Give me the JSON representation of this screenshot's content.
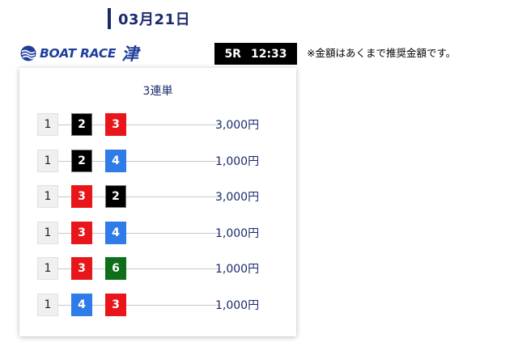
{
  "date": "03月21日",
  "logo": {
    "text": "BOAT RACE",
    "venue": "津"
  },
  "race": {
    "number": "5R",
    "time": "12:33"
  },
  "note": "※金額はあくまで推奨金額です。",
  "bet_type": "3連単",
  "colors": {
    "1": "#f0f0f0",
    "2": "#000000",
    "3": "#e8161b",
    "4": "#2f7be8",
    "6": "#0f6e19",
    "navy": "#1a2a6c"
  },
  "bets": [
    {
      "first": "1",
      "second": "2",
      "third": "3",
      "amount": "3,000円"
    },
    {
      "first": "1",
      "second": "2",
      "third": "4",
      "amount": "1,000円"
    },
    {
      "first": "1",
      "second": "3",
      "third": "2",
      "amount": "3,000円"
    },
    {
      "first": "1",
      "second": "3",
      "third": "4",
      "amount": "1,000円"
    },
    {
      "first": "1",
      "second": "3",
      "third": "6",
      "amount": "1,000円"
    },
    {
      "first": "1",
      "second": "4",
      "third": "3",
      "amount": "1,000円"
    }
  ]
}
